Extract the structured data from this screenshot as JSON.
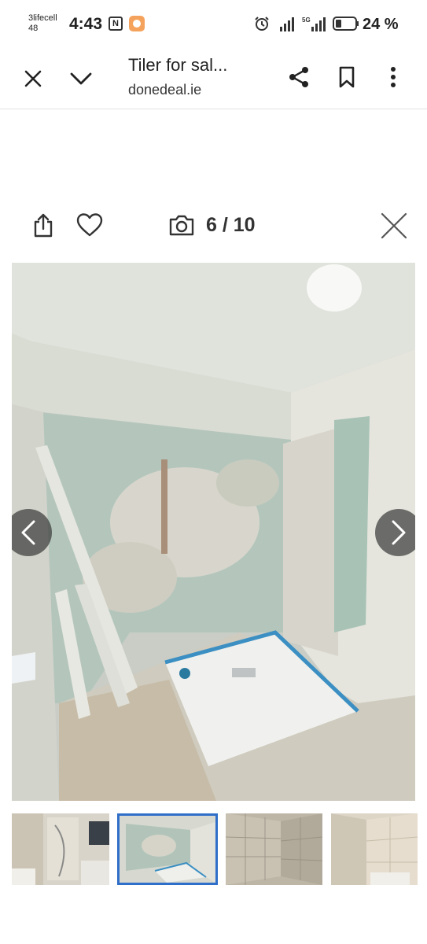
{
  "status_bar": {
    "carrier": "3lifecell",
    "carrier_sub": "48",
    "time": "4:43",
    "network": "5G",
    "battery": "24 %"
  },
  "header": {
    "title": "Tiler for sal...",
    "domain": "donedeal.ie"
  },
  "gallery": {
    "counter": "6 / 10",
    "current_index": 6,
    "total": 10,
    "thumbnails_visible": 4,
    "active_thumbnail": 2
  },
  "colors": {
    "accent": "#2f6ec9",
    "icon": "#333333",
    "divider": "#e2e2e2"
  },
  "icons": [
    "close-icon",
    "chevron-down-icon",
    "share-icon",
    "bookmark-icon",
    "more-vert-icon",
    "export-icon",
    "heart-icon",
    "camera-icon",
    "close-x-icon",
    "chevron-left-icon",
    "chevron-right-icon"
  ]
}
